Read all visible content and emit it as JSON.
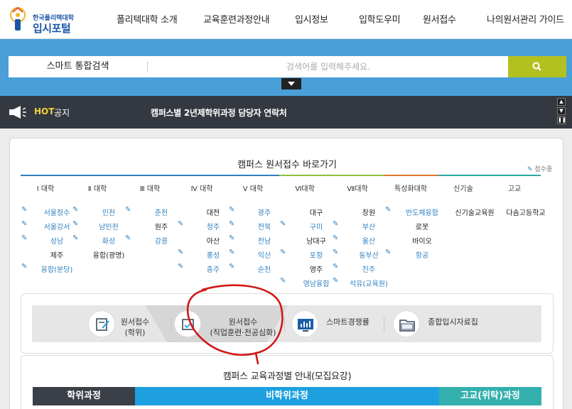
{
  "logo": {
    "small": "한국폴리텍대학",
    "big": "입시포털"
  },
  "nav": [
    {
      "label": "폴리텍대학 소개"
    },
    {
      "label": "교육훈련과정안내"
    },
    {
      "label": "입시정보"
    },
    {
      "label": "입학도우미"
    },
    {
      "label": "원서접수"
    },
    {
      "label": "나의원서관리 가이드"
    }
  ],
  "search": {
    "label": "스마트 통합검색",
    "placeholder": "검색어를 입력해주세요.",
    "button_icon": "search-icon"
  },
  "hot": {
    "label": "HOT",
    "kind": "공지",
    "text": "캠퍼스별 2년제학위과정 담당자 연락처"
  },
  "panel": {
    "title": "캠퍼스 원서접수 바로가기",
    "apply_link": "접수중",
    "tabs": [
      "Ⅰ 대학",
      "Ⅱ 대학",
      "Ⅲ 대학",
      "Ⅳ 대학",
      "Ⅴ 대학",
      "Ⅵ대학",
      "Ⅶ대학",
      "특성화대학",
      "신기술",
      "고교"
    ],
    "tab_colors": [
      "#2f80c1",
      "#2f80c1",
      "#2f80c1",
      "#2f80c1",
      "#2f80c1",
      "#8fbf3a",
      "#8fbf3a",
      "#e0772a",
      "#2aa8a0",
      "#2aa8a0"
    ],
    "campuses": [
      [
        {
          "name": "서울정수",
          "open": true
        },
        {
          "name": "서울강서",
          "open": true
        },
        {
          "name": "성남",
          "open": true
        },
        {
          "name": "제주",
          "open": false
        },
        {
          "name": "융합(분당)",
          "open": true
        }
      ],
      [
        {
          "name": "인천",
          "open": true
        },
        {
          "name": "남인천",
          "open": true
        },
        {
          "name": "화성",
          "open": true
        },
        {
          "name": "융합(광명)",
          "open": false
        }
      ],
      [
        {
          "name": "춘천",
          "open": true
        },
        {
          "name": "원주",
          "open": false
        },
        {
          "name": "강릉",
          "open": true
        }
      ],
      [
        {
          "name": "대전",
          "open": false
        },
        {
          "name": "청주",
          "open": true
        },
        {
          "name": "아산",
          "open": false
        },
        {
          "name": "홍성",
          "open": true
        },
        {
          "name": "충주",
          "open": true
        }
      ],
      [
        {
          "name": "광주",
          "open": true
        },
        {
          "name": "전북",
          "open": true
        },
        {
          "name": "전남",
          "open": true
        },
        {
          "name": "익산",
          "open": true
        },
        {
          "name": "순천",
          "open": true
        }
      ],
      [
        {
          "name": "대구",
          "open": false
        },
        {
          "name": "구미",
          "open": true
        },
        {
          "name": "남대구",
          "open": false
        },
        {
          "name": "포항",
          "open": true
        },
        {
          "name": "영주",
          "open": false
        },
        {
          "name": "영남융합",
          "open": true
        }
      ],
      [
        {
          "name": "창원",
          "open": false
        },
        {
          "name": "부산",
          "open": true
        },
        {
          "name": "울산",
          "open": true
        },
        {
          "name": "동부산",
          "open": true
        },
        {
          "name": "진주",
          "open": true
        },
        {
          "name": "석유(교육원)",
          "open": true
        }
      ],
      [
        {
          "name": "반도체융합",
          "open": true
        },
        {
          "name": "로봇",
          "open": false
        },
        {
          "name": "바이오",
          "open": false
        },
        {
          "name": "항공",
          "open": true
        }
      ],
      [
        {
          "name": "신기술교육원",
          "open": false
        }
      ],
      [
        {
          "name": "다솜고등학교",
          "open": false
        }
      ]
    ]
  },
  "quick": [
    {
      "line1": "원서접수",
      "line2": "(학위)",
      "icon": "application-form-icon"
    },
    {
      "line1": "원서접수",
      "line2": "(직업훈련·전공심화)",
      "icon": "application-edit-icon"
    },
    {
      "line1": "스마트경쟁률",
      "line2": "",
      "icon": "monitor-chart-icon"
    },
    {
      "line1": "종합입시자료집",
      "line2": "",
      "icon": "folder-icon"
    }
  ],
  "guide": {
    "title": "캠퍼스 교육과정별 안내(모집요강)",
    "tabs": [
      {
        "label": "학위과정",
        "color": "#3a3f48"
      },
      {
        "label": "비학위과정",
        "color": "#1ea0e0"
      },
      {
        "label": "고교(위탁)과정",
        "color": "#33b0ad"
      }
    ]
  }
}
